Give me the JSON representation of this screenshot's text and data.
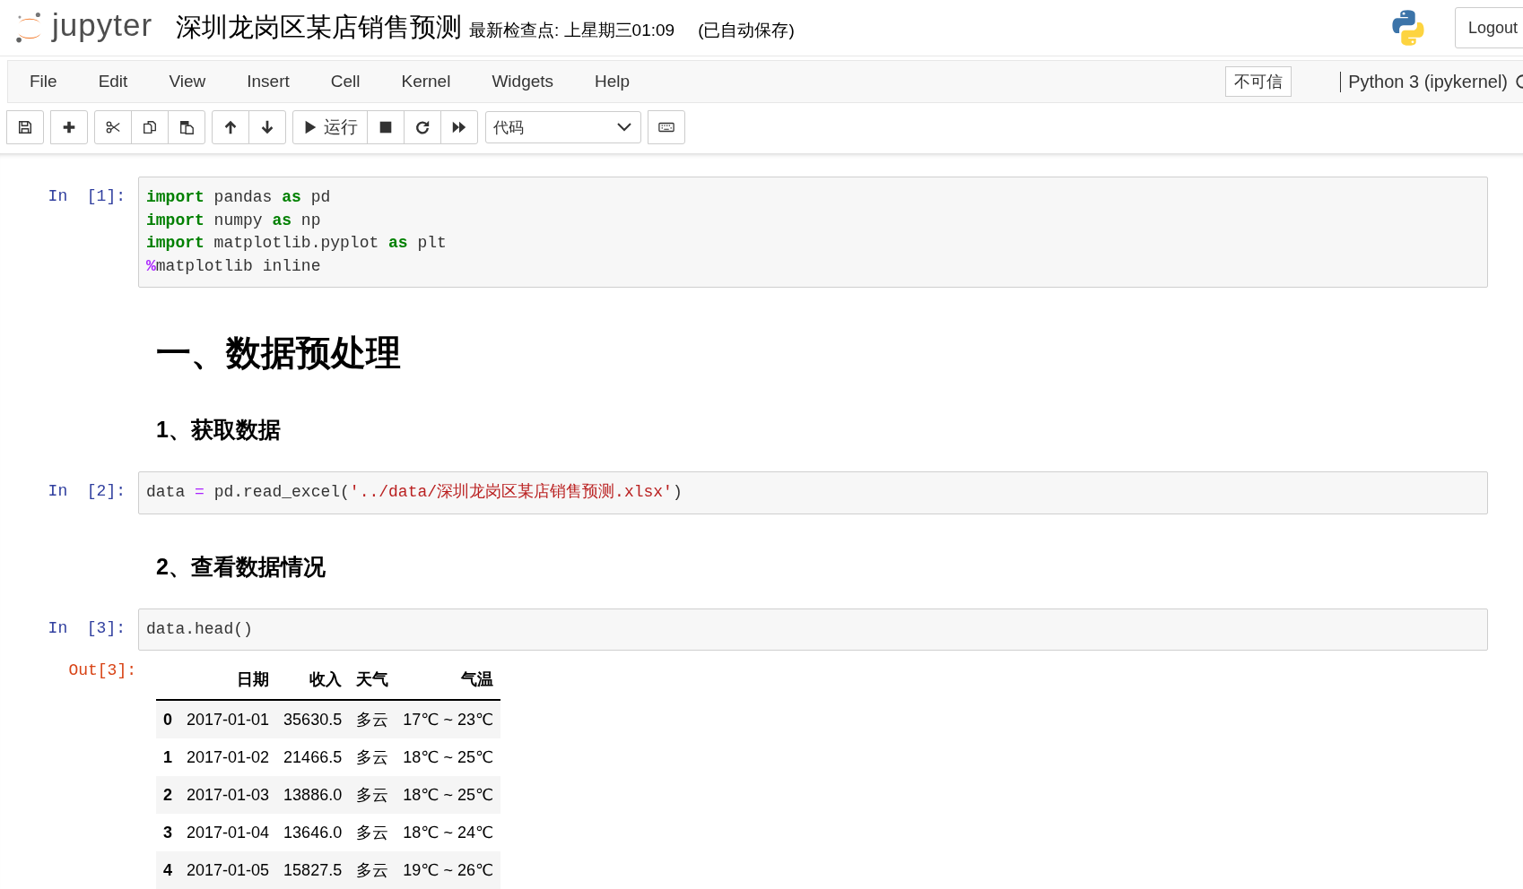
{
  "header": {
    "logo_text": "jupyter",
    "notebook_name": "深圳龙岗区某店销售预测",
    "checkpoint": "最新检查点: 上星期三01:09",
    "autosave": "(已自动保存)",
    "logout": "Logout"
  },
  "menu": [
    "File",
    "Edit",
    "View",
    "Insert",
    "Cell",
    "Kernel",
    "Widgets",
    "Help"
  ],
  "trust": "不可信",
  "kernel": "Python 3 (ipykernel)",
  "toolbar": [
    {
      "kind": "group",
      "buttons": [
        {
          "kind": "save"
        }
      ]
    },
    {
      "kind": "group",
      "buttons": [
        {
          "kind": "plus"
        }
      ]
    },
    {
      "kind": "group",
      "buttons": [
        {
          "kind": "cut"
        },
        {
          "kind": "copy"
        },
        {
          "kind": "paste"
        }
      ]
    },
    {
      "kind": "group",
      "buttons": [
        {
          "kind": "up"
        },
        {
          "kind": "down"
        }
      ]
    },
    {
      "kind": "group",
      "buttons": [
        {
          "kind": "run",
          "label": "运行"
        },
        {
          "kind": "stop"
        },
        {
          "kind": "restart"
        },
        {
          "kind": "forward"
        }
      ]
    },
    {
      "kind": "select",
      "value": "代码"
    },
    {
      "kind": "group",
      "buttons": [
        {
          "kind": "keyboard"
        }
      ]
    }
  ],
  "cells": [
    {
      "kind": "code",
      "prompt_in": "In",
      "prompt_num": "[1]:",
      "lines": [
        [
          {
            "kind": "keyword",
            "s": "import"
          },
          {
            "kind": "plain",
            "s": " pandas "
          },
          {
            "kind": "keyword",
            "s": "as"
          },
          {
            "kind": "plain",
            "s": " pd"
          }
        ],
        [
          {
            "kind": "keyword",
            "s": "import"
          },
          {
            "kind": "plain",
            "s": " numpy "
          },
          {
            "kind": "keyword",
            "s": "as"
          },
          {
            "kind": "plain",
            "s": " np"
          }
        ],
        [
          {
            "kind": "keyword",
            "s": "import"
          },
          {
            "kind": "plain",
            "s": " matplotlib.pyplot "
          },
          {
            "kind": "keyword",
            "s": "as"
          },
          {
            "kind": "plain",
            "s": " plt"
          }
        ],
        [
          {
            "kind": "magic",
            "s": "%"
          },
          {
            "kind": "plain",
            "s": "matplotlib inline"
          }
        ]
      ]
    },
    {
      "kind": "heading1",
      "text": "一、数据预处理"
    },
    {
      "kind": "heading2",
      "text": "1、获取数据"
    },
    {
      "kind": "code",
      "prompt_in": "In",
      "prompt_num": "[2]:",
      "lines": [
        [
          {
            "kind": "plain",
            "s": "data "
          },
          {
            "kind": "operator",
            "s": "="
          },
          {
            "kind": "plain",
            "s": " pd.read_excel("
          },
          {
            "kind": "string",
            "s": "'../data/深圳龙岗区某店销售预测.xlsx'"
          },
          {
            "kind": "plain",
            "s": ")"
          }
        ]
      ]
    },
    {
      "kind": "heading2",
      "text": "2、查看数据情况"
    },
    {
      "kind": "code",
      "prompt_in": "In",
      "prompt_num": "[3]:",
      "lines": [
        [
          {
            "kind": "plain",
            "s": "data.head()"
          }
        ]
      ]
    },
    {
      "kind": "output",
      "prompt": "Out[3]:",
      "table": {
        "columns": [
          "日期",
          "收入",
          "天气",
          "气温"
        ],
        "rows": [
          {
            "index": "0",
            "cells": [
              "2017-01-01",
              "35630.5",
              "多云",
              "17℃ ~ 23℃"
            ]
          },
          {
            "index": "1",
            "cells": [
              "2017-01-02",
              "21466.5",
              "多云",
              "18℃ ~ 25℃"
            ]
          },
          {
            "index": "2",
            "cells": [
              "2017-01-03",
              "13886.0",
              "多云",
              "18℃ ~ 25℃"
            ]
          },
          {
            "index": "3",
            "cells": [
              "2017-01-04",
              "13646.0",
              "多云",
              "18℃ ~ 24℃"
            ]
          },
          {
            "index": "4",
            "cells": [
              "2017-01-05",
              "15827.5",
              "多云",
              "19℃ ~ 26℃"
            ]
          }
        ]
      }
    }
  ]
}
